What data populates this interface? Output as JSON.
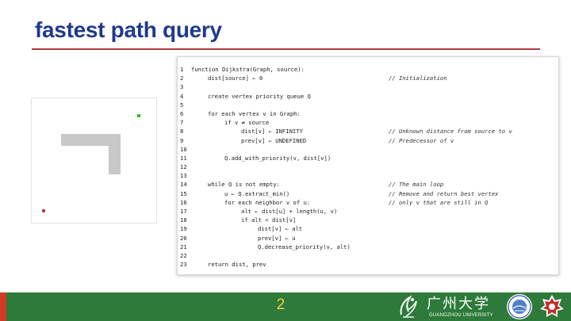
{
  "slide": {
    "title": "fastest path query",
    "page_number": "2"
  },
  "grid_figure": {
    "start_marker_color": "#cc1a1a",
    "goal_marker_color": "#22c322",
    "wall_color": "#c8c8c8"
  },
  "code": {
    "lines": [
      {
        "n": "1",
        "indent": 0,
        "text": "function Dijkstra(Graph, source):",
        "comment": ""
      },
      {
        "n": "2",
        "indent": 1,
        "text": "dist[source] ← 0",
        "comment": "// Initialization"
      },
      {
        "n": "3",
        "indent": 0,
        "text": "",
        "comment": ""
      },
      {
        "n": "4",
        "indent": 1,
        "text": "create vertex priority queue Q",
        "comment": ""
      },
      {
        "n": "5",
        "indent": 0,
        "text": "",
        "comment": ""
      },
      {
        "n": "6",
        "indent": 1,
        "text": "for each vertex v in Graph:",
        "comment": ""
      },
      {
        "n": "7",
        "indent": 2,
        "text": "if v ≠ source",
        "comment": ""
      },
      {
        "n": "8",
        "indent": 3,
        "text": "dist[v] ← INFINITY",
        "comment": "// Unknown distance from source to v"
      },
      {
        "n": "9",
        "indent": 3,
        "text": "prev[v] ← UNDEFINED",
        "comment": "// Predecessor of v"
      },
      {
        "n": "10",
        "indent": 0,
        "text": "",
        "comment": ""
      },
      {
        "n": "11",
        "indent": 2,
        "text": "Q.add_with_priority(v, dist[v])",
        "comment": ""
      },
      {
        "n": "12",
        "indent": 0,
        "text": "",
        "comment": ""
      },
      {
        "n": "13",
        "indent": 0,
        "text": "",
        "comment": ""
      },
      {
        "n": "14",
        "indent": 1,
        "text": "while Q is not empty:",
        "comment": "// The main loop"
      },
      {
        "n": "15",
        "indent": 2,
        "text": "u ← Q.extract_min()",
        "comment": "// Remove and return best vertex"
      },
      {
        "n": "16",
        "indent": 2,
        "text": "for each neighbor v of u:",
        "comment": "// only v that are still in Q"
      },
      {
        "n": "17",
        "indent": 3,
        "text": "alt ← dist[u] + length(u, v)",
        "comment": ""
      },
      {
        "n": "18",
        "indent": 3,
        "text": "if alt < dist[v]",
        "comment": ""
      },
      {
        "n": "19",
        "indent": 4,
        "text": "dist[v] ← alt",
        "comment": ""
      },
      {
        "n": "20",
        "indent": 4,
        "text": "prev[v] ← u",
        "comment": ""
      },
      {
        "n": "21",
        "indent": 4,
        "text": "Q.decrease_priority(v, alt)",
        "comment": ""
      },
      {
        "n": "22",
        "indent": 0,
        "text": "",
        "comment": ""
      },
      {
        "n": "23",
        "indent": 1,
        "text": "return dist, prev",
        "comment": ""
      }
    ]
  },
  "footer": {
    "university_name_cn": "广州大学",
    "university_name_en": "GUANGZHOU UNIVERSITY",
    "bar_color": "#2e7a3a",
    "accent_color": "#d23a2a",
    "page_number_color": "#f2d23c"
  }
}
